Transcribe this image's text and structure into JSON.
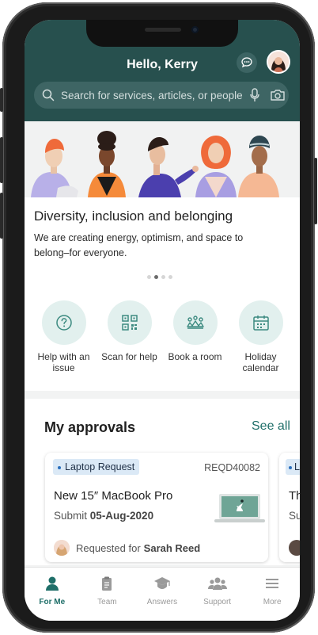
{
  "header": {
    "greeting": "Hello, Kerry",
    "search_placeholder": "Search for services, articles, or people"
  },
  "hero": {
    "title": "Diversity, inclusion and belonging",
    "text": "We are creating energy, optimism, and space to belong–for everyone.",
    "carousel": {
      "count": 4,
      "active_index": 1
    }
  },
  "quick_actions": [
    {
      "label": "Help with an issue",
      "icon": "question-icon"
    },
    {
      "label": "Scan for help",
      "icon": "qr-code-icon"
    },
    {
      "label": "Book a room",
      "icon": "room-icon"
    },
    {
      "label": "Holiday calendar",
      "icon": "calendar-icon"
    }
  ],
  "approvals": {
    "title": "My approvals",
    "see_all": "See all",
    "card": {
      "tag": "Laptop Request",
      "id": "REQD40082",
      "title": "New 15″ MacBook Pro",
      "submit_label": "Submit",
      "submit_date": "05-Aug-2020",
      "requested_label": "Requested for",
      "requested_name": "Sarah Reed"
    },
    "card_peek": {
      "tag_prefix": "L",
      "title_prefix": "Th",
      "sub_prefix": "Su"
    }
  },
  "tabs": [
    {
      "label": "For Me",
      "icon": "person-icon",
      "active": true
    },
    {
      "label": "Team",
      "icon": "clipboard-icon",
      "active": false
    },
    {
      "label": "Answers",
      "icon": "graduation-cap-icon",
      "active": false
    },
    {
      "label": "Support",
      "icon": "people-icon",
      "active": false
    },
    {
      "label": "More",
      "icon": "menu-icon",
      "active": false
    }
  ],
  "colors": {
    "header_bg": "#27504e",
    "accent": "#1f6f69",
    "tag_bg": "#dbe9f6"
  }
}
